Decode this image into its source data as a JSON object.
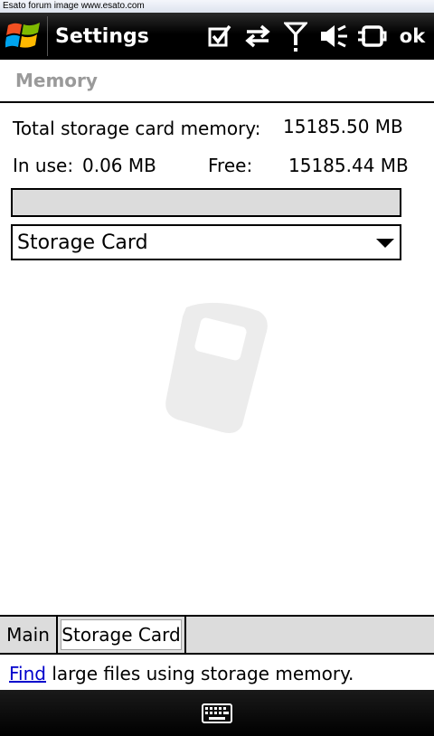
{
  "watermark": "Esato forum image www.esato.com",
  "titlebar": {
    "title": "Settings",
    "ok_label": "ok",
    "icons": [
      "windows-start-icon",
      "checkbox-icon",
      "sync-arrows-icon",
      "signal-antenna-icon",
      "speaker-muted-icon",
      "battery-plug-icon"
    ]
  },
  "section": {
    "title": "Memory"
  },
  "storage": {
    "total_label": "Total storage card memory:",
    "total_value": "15185.50 MB",
    "inuse_label": "In use:",
    "inuse_value": "0.06 MB",
    "free_label": "Free:",
    "free_value": "15185.44 MB",
    "usage_fraction": 4e-06
  },
  "selector": {
    "value": "Storage Card"
  },
  "tabs": [
    {
      "label": "Main",
      "active": false
    },
    {
      "label": "Storage Card",
      "active": true
    }
  ],
  "find": {
    "link_label": "Find",
    "rest": " large files using storage memory."
  },
  "softbar": {
    "icon": "keyboard-icon"
  },
  "colors": {
    "accent": "#3a62b8",
    "link": "#0000cc",
    "header_text": "#9a9a9a"
  }
}
